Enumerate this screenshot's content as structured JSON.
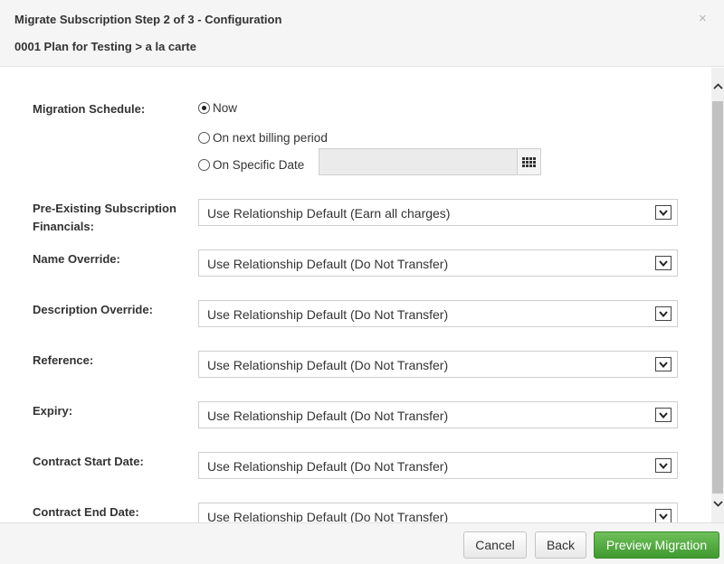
{
  "dialog": {
    "title": "Migrate Subscription Step 2 of 3 - Configuration",
    "subtitle": "0001 Plan for Testing > a la carte",
    "close_symbol": "×"
  },
  "schedule": {
    "label": "Migration Schedule:",
    "options": [
      {
        "label": "Now",
        "checked": true
      },
      {
        "label": "On next billing period",
        "checked": false
      },
      {
        "label": "On Specific Date",
        "checked": false
      }
    ],
    "date_value": ""
  },
  "fields": [
    {
      "label_line1": "Pre-Existing Subscription",
      "label_line2": "Financials:",
      "value": "Use Relationship Default (Earn all charges)"
    },
    {
      "label_line1": "Name Override:",
      "value": "Use Relationship Default (Do Not Transfer)"
    },
    {
      "label_line1": "Description Override:",
      "value": "Use Relationship Default (Do Not Transfer)"
    },
    {
      "label_line1": "Reference:",
      "value": "Use Relationship Default (Do Not Transfer)"
    },
    {
      "label_line1": "Expiry:",
      "value": "Use Relationship Default (Do Not Transfer)"
    },
    {
      "label_line1": "Contract Start Date:",
      "value": "Use Relationship Default (Do Not Transfer)"
    },
    {
      "label_line1": "Contract End Date:",
      "value": "Use Relationship Default (Do Not Transfer)"
    }
  ],
  "footer": {
    "cancel_label": "Cancel",
    "back_label": "Back",
    "preview_label": "Preview Migration"
  },
  "colors": {
    "header_bg": "#f5f5f5",
    "primary_button": "#4aa536",
    "scroll_thumb": "#c1c1c1"
  },
  "icons": [
    "close-icon",
    "calendar-icon",
    "dropdown-arrow-icon",
    "scroll-up-icon",
    "scroll-down-icon"
  ]
}
